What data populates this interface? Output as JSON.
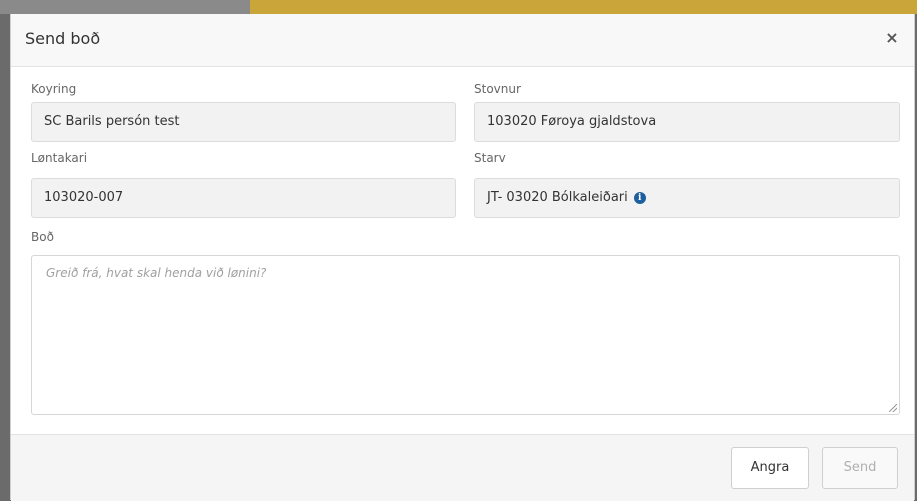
{
  "modal": {
    "title": "Send boð",
    "close_glyph": "×"
  },
  "fields": {
    "koyring": {
      "label": "Koyring",
      "value": "SC Barils persón test"
    },
    "stovnur": {
      "label": "Stovnur",
      "value": "103020 Føroya gjaldstova"
    },
    "lontakari": {
      "label": "Løntakari",
      "value": "103020-007"
    },
    "starv": {
      "label": "Starv",
      "value": "JT- 03020 Bólkaleiðari",
      "info_icon": "info-icon"
    },
    "bod": {
      "label": "Boð",
      "placeholder": "Greið frá, hvat skal henda við lønini?"
    }
  },
  "footer": {
    "cancel_label": "Angra",
    "send_label": "Send"
  },
  "colors": {
    "info_icon": "#1f5f9e"
  }
}
